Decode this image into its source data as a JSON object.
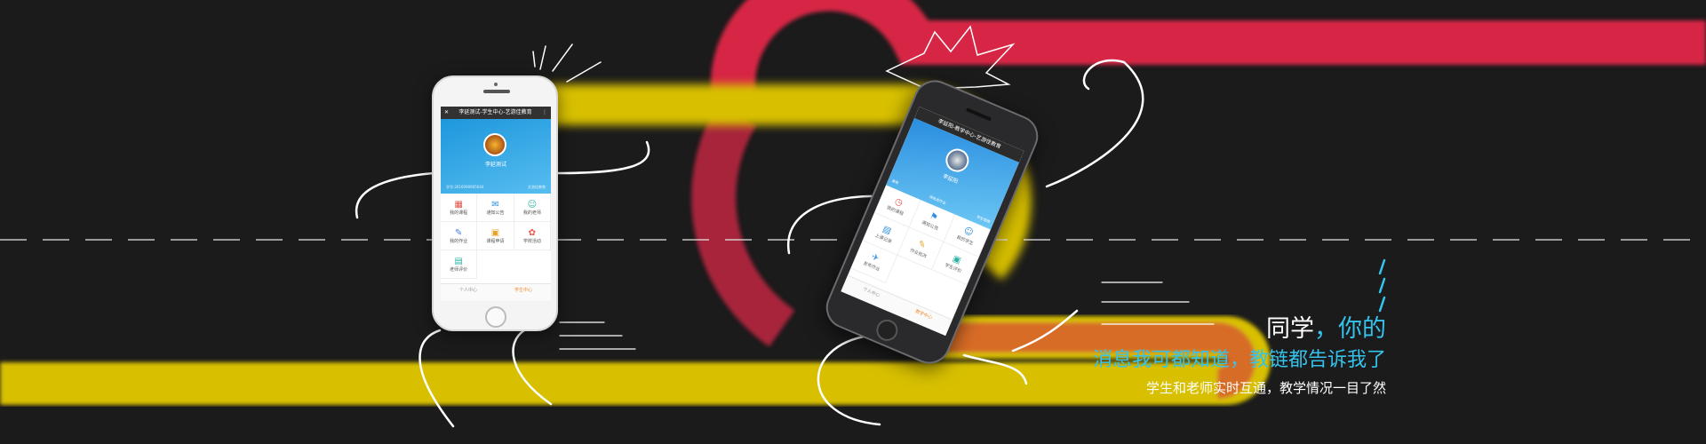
{
  "colors": {
    "background": "#1b1b1b",
    "yellow": "#d8c000",
    "red": "#d72645",
    "cyan": "#35c3ee",
    "screen_blue": "#1d97dc",
    "accent_orange": "#f28a2b"
  },
  "phone_left": {
    "title_bar": "李延测试-学生中心-艺游佳教育",
    "close_icon": "✕",
    "menu_icon": "⋮",
    "user_name": "李延测试",
    "sub_left": "学号:2016090905044",
    "sub_right": "艺游佳教育",
    "grid": [
      {
        "icon": "▦",
        "label": "我的课程",
        "color": "#e2564a"
      },
      {
        "icon": "✉",
        "label": "通知公告",
        "color": "#2f8fe0"
      },
      {
        "icon": "☺",
        "label": "我的老师",
        "color": "#2bb3a0"
      },
      {
        "icon": "✎",
        "label": "我的作业",
        "color": "#3f7fd8"
      },
      {
        "icon": "▣",
        "label": "课程申请",
        "color": "#e5a32a"
      },
      {
        "icon": "✿",
        "label": "学校活动",
        "color": "#e2564a"
      },
      {
        "icon": "▤",
        "label": "老师评价",
        "color": "#2bb3a0"
      }
    ],
    "tabs": [
      {
        "label": "个人中心",
        "on": false
      },
      {
        "label": "学生中心",
        "on": true
      }
    ]
  },
  "phone_right": {
    "title_bar": "李延阳-教学中心-艺游佳教育",
    "user_name": "李延阳",
    "sub_items": [
      "课表",
      "待批改作业",
      "学生管理"
    ],
    "grid": [
      {
        "icon": "◷",
        "label": "我的课程",
        "color": "#e2564a"
      },
      {
        "icon": "⚑",
        "label": "通知公告",
        "color": "#2f8fe0"
      },
      {
        "icon": "☺",
        "label": "我的学生",
        "color": "#2f8fe0"
      },
      {
        "icon": "▤",
        "label": "上课记录",
        "color": "#2f8fe0"
      },
      {
        "icon": "✎",
        "label": "作业批改",
        "color": "#e5a32a"
      },
      {
        "icon": "▣",
        "label": "学生评价",
        "color": "#2bb3a0"
      },
      {
        "icon": "✈",
        "label": "发布作业",
        "color": "#2f8fe0"
      }
    ],
    "tabs": [
      {
        "label": "个人中心",
        "on": false
      },
      {
        "label": "教学中心",
        "on": true
      }
    ]
  },
  "caption": {
    "line1_white": "同学",
    "line1_cyan": "，你的",
    "line2": "消息我可都知道，教链都告诉我了",
    "line3": "学生和老师实时互通，教学情况一目了然"
  }
}
